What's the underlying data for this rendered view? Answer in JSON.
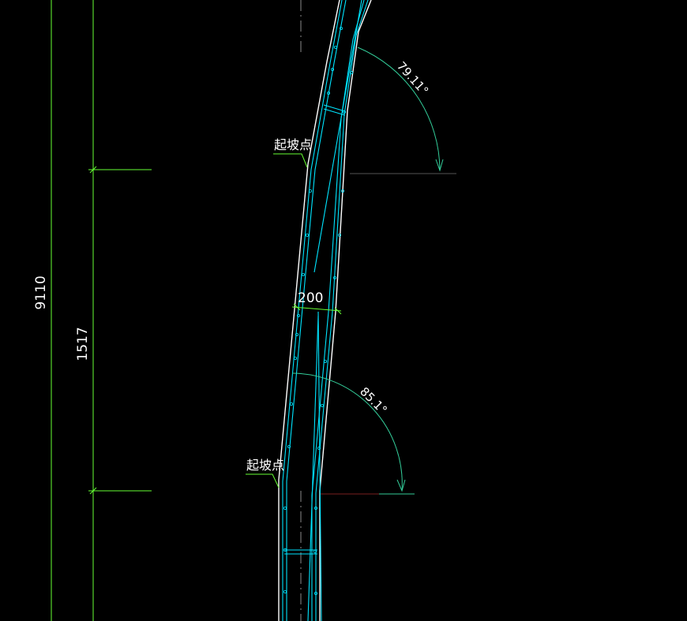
{
  "drawing": {
    "background_color": "#000000",
    "colors": {
      "dimension": "#66ff33",
      "outline": "#ffffff",
      "rebar": "#00e5ff",
      "angle_arc": "#33cc99",
      "reference": "#ff3333"
    },
    "dimensions": {
      "total_height": "9110",
      "segment_height": "1517",
      "wall_thickness": "200"
    },
    "slope_labels": {
      "upper": "起坡点",
      "lower": "起坡点"
    },
    "angles": {
      "upper": "79.11°",
      "lower": "85.1°"
    }
  }
}
